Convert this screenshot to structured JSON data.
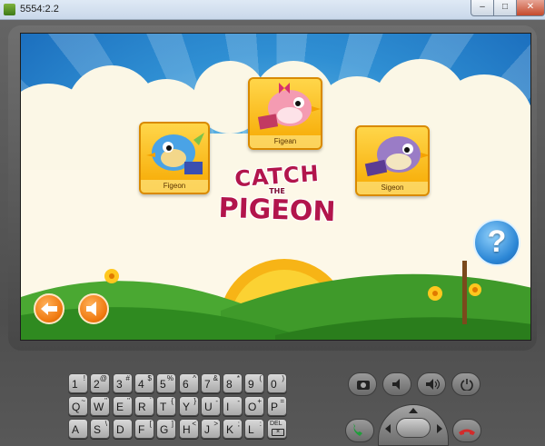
{
  "window": {
    "title": "5554:2.2",
    "minimize_glyph": "–",
    "maximize_glyph": "□",
    "close_glyph": "✕"
  },
  "game": {
    "birds": [
      {
        "name": "Figeon",
        "color": "#4aa3e6",
        "icon": "blue-pigeon-icon"
      },
      {
        "name": "Figean",
        "color": "#f49bb2",
        "icon": "pink-pigeon-icon"
      },
      {
        "name": "Sigeon",
        "color": "#9a7cc6",
        "icon": "purple-pigeon-icon"
      }
    ],
    "logo": {
      "line1": "CATCH",
      "line2": "THE",
      "line3": "PIGEON"
    },
    "help_label": "?",
    "back_icon": "back-arrow-icon",
    "sound_icon": "speaker-icon"
  },
  "controls": {
    "row1": [
      {
        "icon": "camera-icon"
      },
      {
        "icon": "volume-down-icon"
      },
      {
        "icon": "volume-up-icon"
      },
      {
        "icon": "power-icon"
      }
    ],
    "call_icon": "call-icon",
    "end_call_icon": "end-call-icon"
  },
  "keyboard": {
    "rows": [
      [
        {
          "main": "1",
          "alt": "!"
        },
        {
          "main": "2",
          "alt": "@"
        },
        {
          "main": "3",
          "alt": "#"
        },
        {
          "main": "4",
          "alt": "$"
        },
        {
          "main": "5",
          "alt": "%"
        },
        {
          "main": "6",
          "alt": "^"
        },
        {
          "main": "7",
          "alt": "&"
        },
        {
          "main": "8",
          "alt": "*"
        },
        {
          "main": "9",
          "alt": "("
        },
        {
          "main": "0",
          "alt": ")"
        }
      ],
      [
        {
          "main": "Q",
          "alt": "~"
        },
        {
          "main": "W",
          "alt": "\""
        },
        {
          "main": "E",
          "alt": "\""
        },
        {
          "main": "R",
          "alt": "`"
        },
        {
          "main": "T",
          "alt": "{"
        },
        {
          "main": "Y",
          "alt": "}"
        },
        {
          "main": "U",
          "alt": "-"
        },
        {
          "main": "I",
          "alt": "-"
        },
        {
          "main": "O",
          "alt": "+"
        },
        {
          "main": "P",
          "alt": "="
        }
      ],
      [
        {
          "main": "A",
          "alt": ""
        },
        {
          "main": "S",
          "alt": "\\"
        },
        {
          "main": "D",
          "alt": ""
        },
        {
          "main": "F",
          "alt": "["
        },
        {
          "main": "G",
          "alt": "]"
        },
        {
          "main": "H",
          "alt": "<"
        },
        {
          "main": "J",
          "alt": ">"
        },
        {
          "main": "K",
          "alt": ";"
        },
        {
          "main": "L",
          "alt": ":"
        },
        {
          "main": "DEL",
          "alt": ""
        }
      ]
    ]
  }
}
